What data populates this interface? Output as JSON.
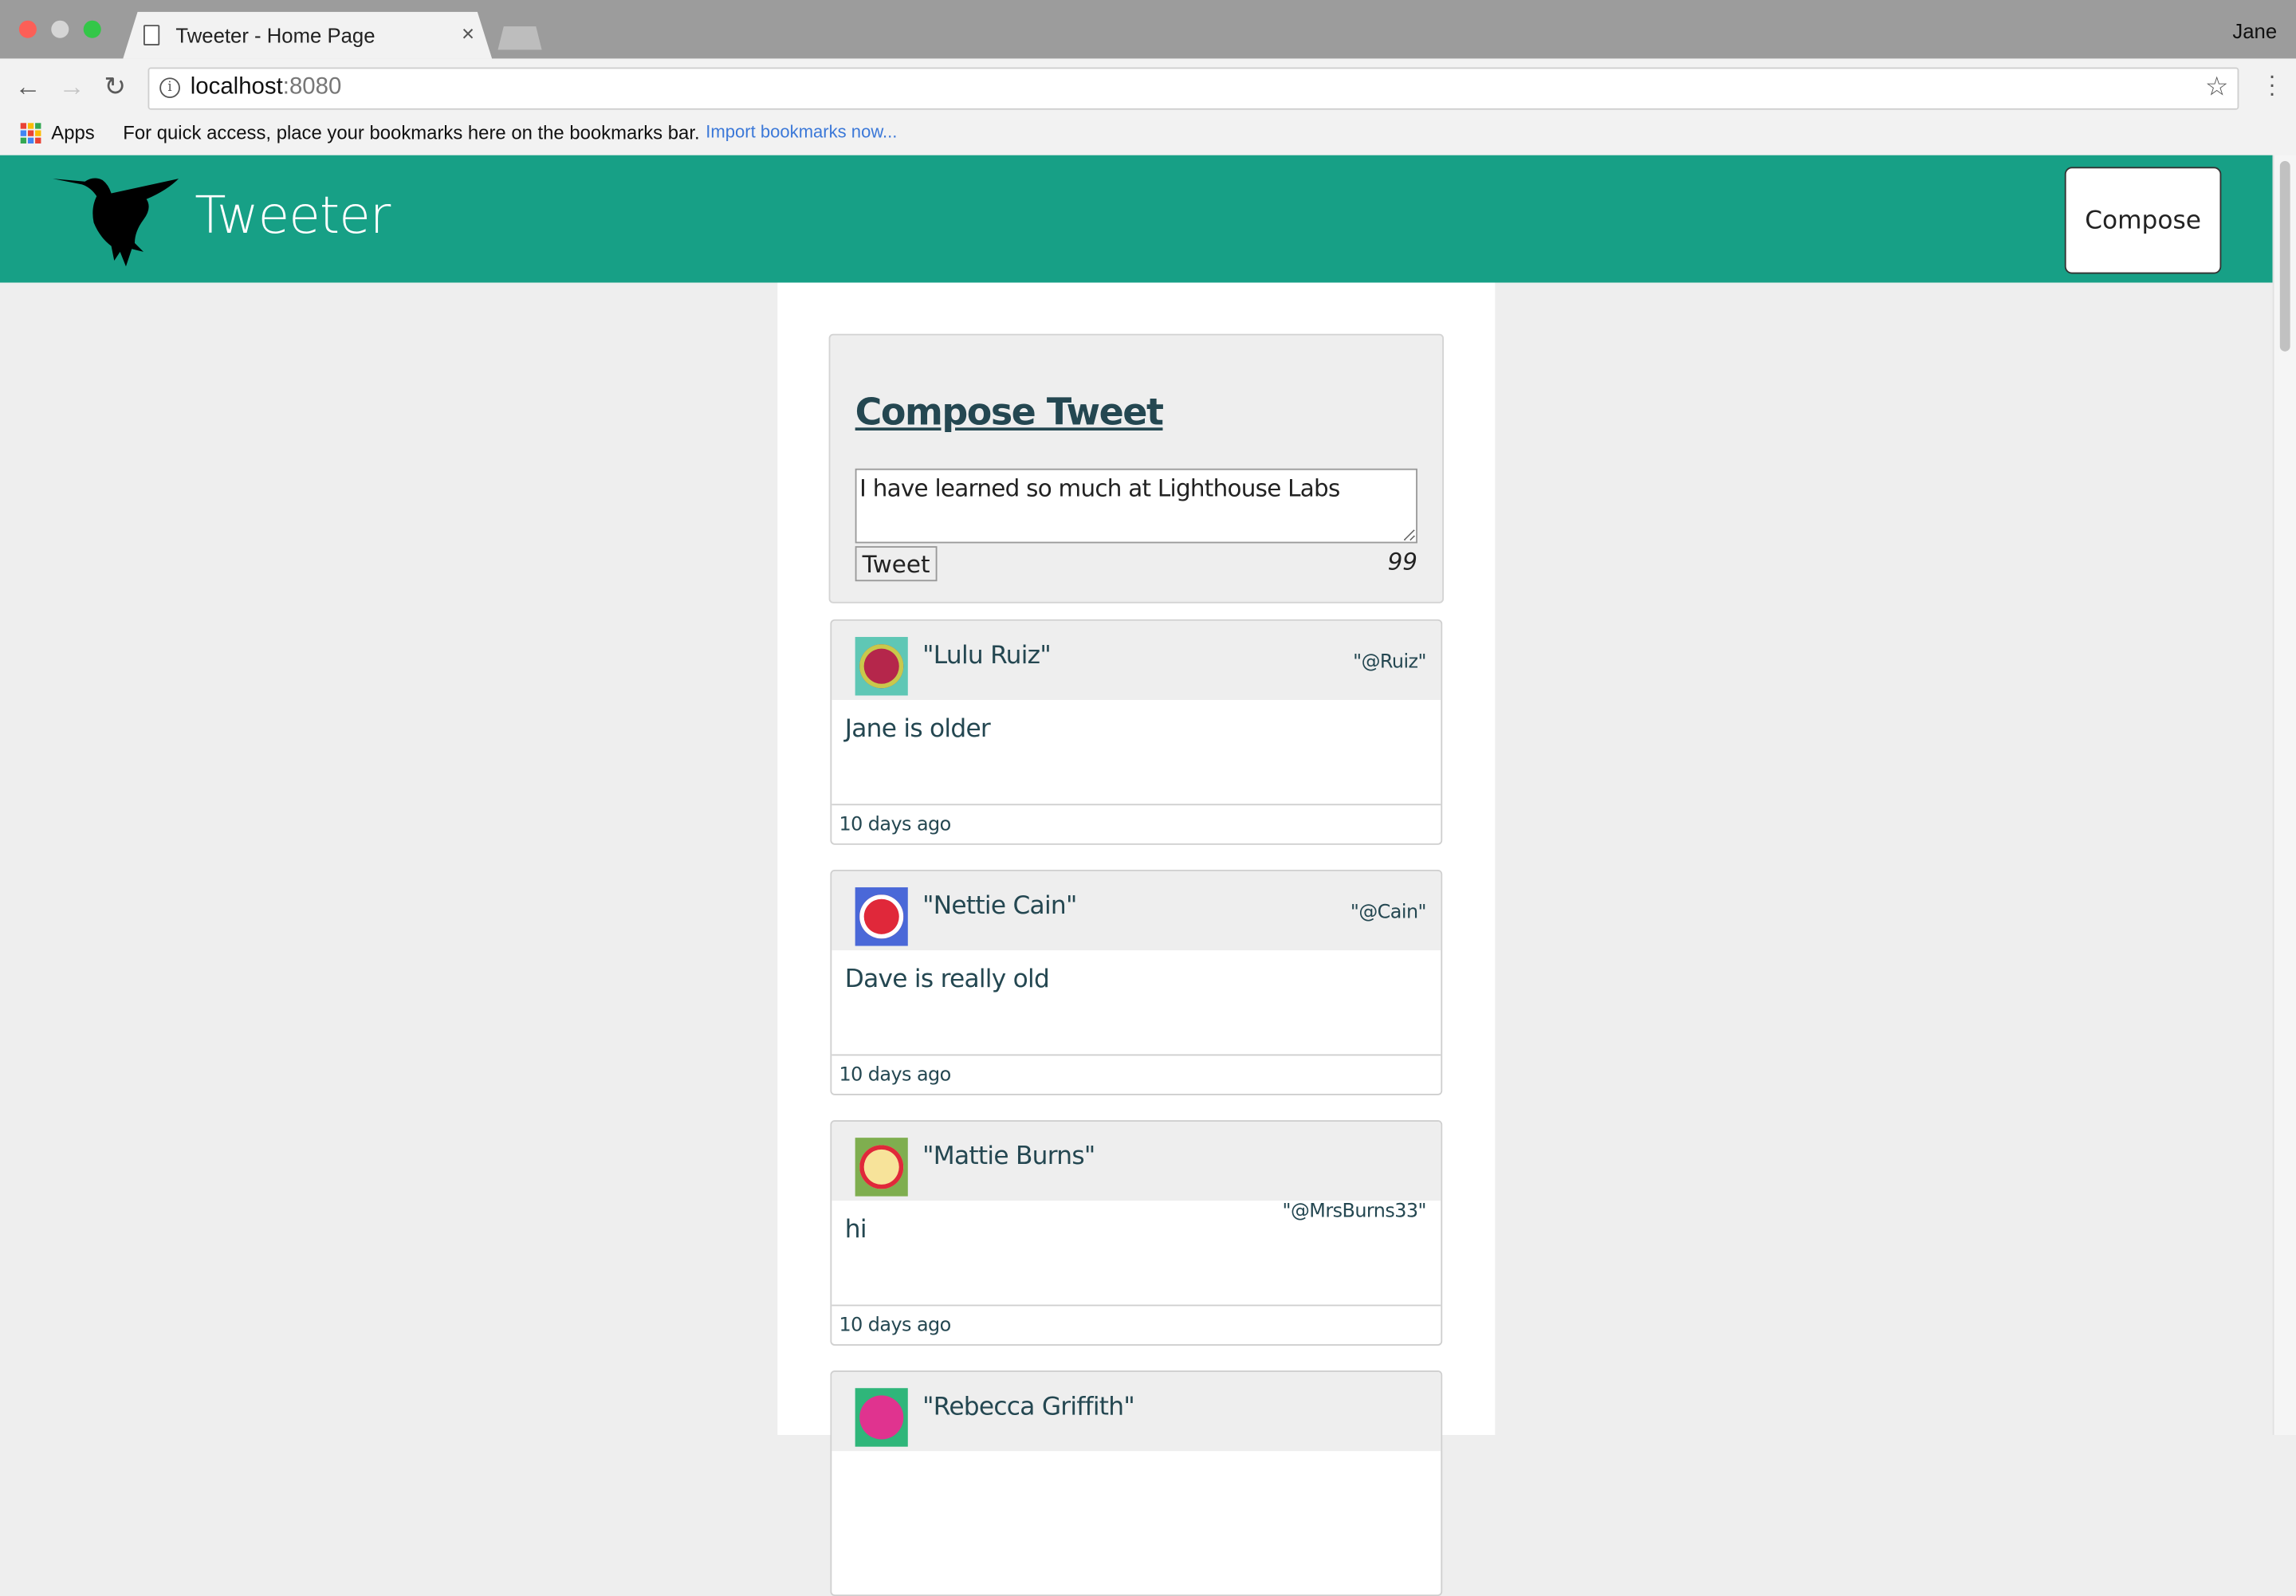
{
  "browser": {
    "tab_title": "Tweeter - Home Page",
    "tab_close": "×",
    "profile_name": "Jane",
    "url_host": "localhost",
    "url_port": ":8080",
    "bookmarks": {
      "apps_label": "Apps",
      "hint": "For quick access, place your bookmarks here on the bookmarks bar.",
      "import_link": "Import bookmarks now..."
    }
  },
  "header": {
    "brand": "Tweeter",
    "compose_label": "Compose",
    "colors": {
      "nav_bg": "#17a086"
    }
  },
  "compose": {
    "title": "Compose Tweet",
    "textarea_value": "I have learned so much at Lighthouse Labs",
    "submit_label": "Tweet",
    "counter": "99"
  },
  "tweets": [
    {
      "name": "\"Lulu Ruiz\"",
      "handle": "\"@Ruiz\"",
      "content": "Jane is older",
      "time": "10 days ago",
      "avatar_bg": "#5fc7b5",
      "avatar_face": "#b5264b"
    },
    {
      "name": "\"Nettie Cain\"",
      "handle": "\"@Cain\"",
      "content": "Dave is really old",
      "time": "10 days ago",
      "avatar_bg": "#4a68d8",
      "avatar_face": "#e0283a"
    },
    {
      "name": "\"Mattie Burns\"",
      "handle": "\"@MrsBurns33\"",
      "content": "hi",
      "time": "10 days ago",
      "avatar_bg": "#7fae4f",
      "avatar_face": "#f7e39a"
    },
    {
      "name": "\"Rebecca Griffith\"",
      "handle": "",
      "content": "",
      "time": "",
      "avatar_bg": "#2fb67a",
      "avatar_face": "#e0338f"
    }
  ]
}
